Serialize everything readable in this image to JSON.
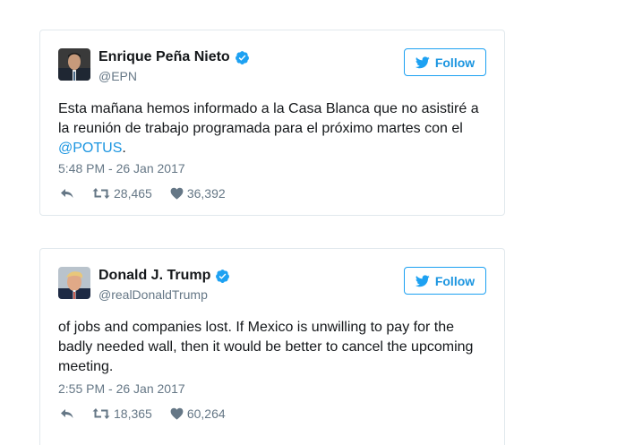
{
  "tweets": [
    {
      "name": "Enrique Peña Nieto",
      "handle": "@EPN",
      "follow_label": "Follow",
      "text_before": "Esta mañana hemos informado a la Casa Blanca que no asistiré a la reunión de trabajo programada para el próximo martes con el ",
      "mention": "@POTUS",
      "text_after": ".",
      "timestamp": "5:48 PM - 26 Jan 2017",
      "retweets": "28,465",
      "likes": "36,392"
    },
    {
      "name": "Donald J. Trump",
      "handle": "@realDonaldTrump",
      "follow_label": "Follow",
      "text": "of jobs and companies lost. If Mexico is unwilling to pay for the badly needed wall, then it would be better to cancel the upcoming meeting.",
      "timestamp": "2:55 PM - 26 Jan 2017",
      "retweets": "18,365",
      "likes": "60,264"
    }
  ],
  "icons": {
    "verified": "verified-badge-icon",
    "bird": "twitter-bird-icon",
    "reply": "reply-icon",
    "retweet": "retweet-icon",
    "like": "heart-icon"
  },
  "colors": {
    "accent": "#1da1f2",
    "link": "#1b95e0",
    "muted": "#657786",
    "text": "#14171a",
    "border": "#e1e8ed"
  }
}
